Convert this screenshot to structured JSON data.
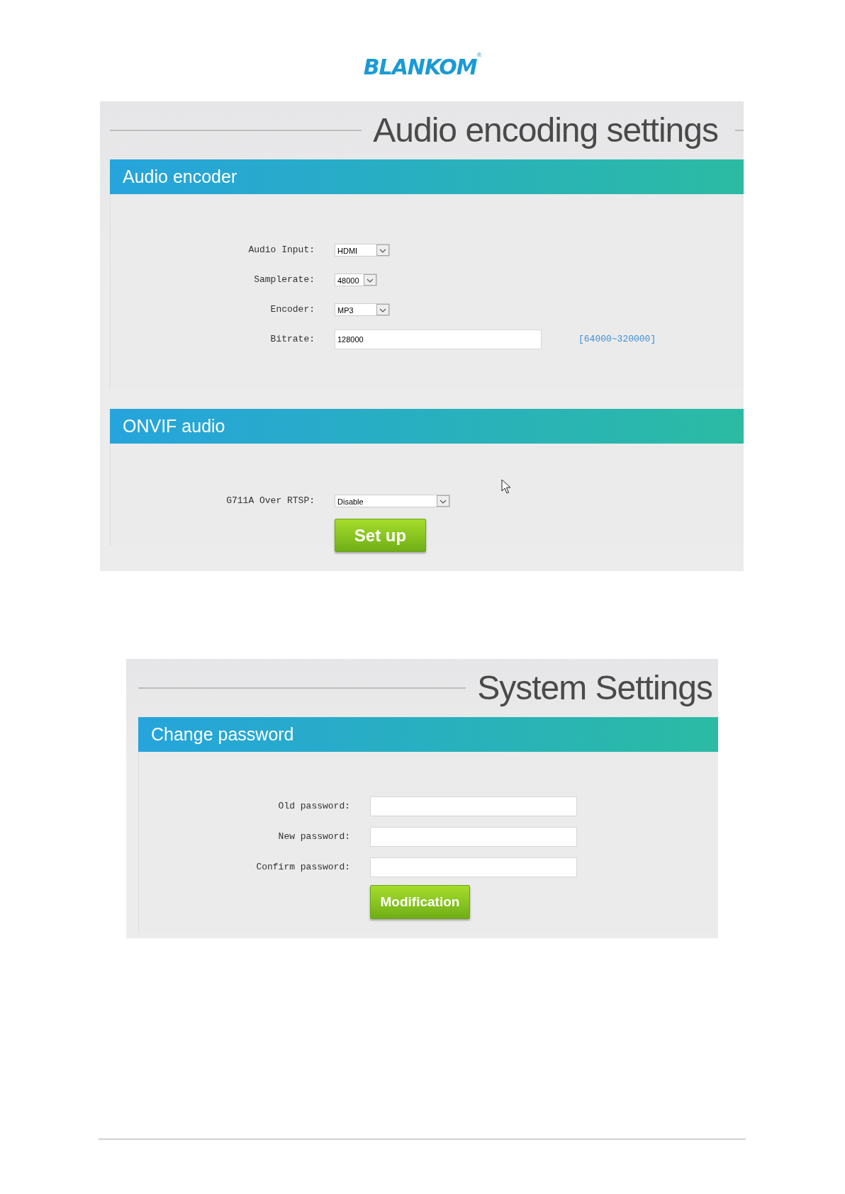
{
  "logo": {
    "text": "BLANKOM",
    "mark": "®"
  },
  "screens": [
    {
      "title": "Audio encoding settings",
      "sections": [
        {
          "title": "Audio encoder",
          "fields": [
            {
              "label": "Audio Input:",
              "kind": "select",
              "value": "HDMI"
            },
            {
              "label": "Samplerate:",
              "kind": "select",
              "value": "48000"
            },
            {
              "label": "Encoder:",
              "kind": "select",
              "value": "MP3"
            },
            {
              "label": "Bitrate:",
              "kind": "text",
              "value": "128000",
              "hint": "[64000~320000]"
            }
          ]
        },
        {
          "title": "ONVIF audio",
          "fields": [
            {
              "label": "G711A Over RTSP:",
              "kind": "select",
              "value": "Disable"
            }
          ],
          "cursor": true,
          "button": "Set up"
        }
      ]
    },
    {
      "title": "System Settings",
      "sections": [
        {
          "title": "Change password",
          "fields": [
            {
              "label": "Old password:",
              "kind": "text"
            },
            {
              "label": "New password:",
              "kind": "text"
            },
            {
              "label": "Confirm password:",
              "kind": "text"
            }
          ],
          "button": "Modification"
        }
      ]
    }
  ]
}
